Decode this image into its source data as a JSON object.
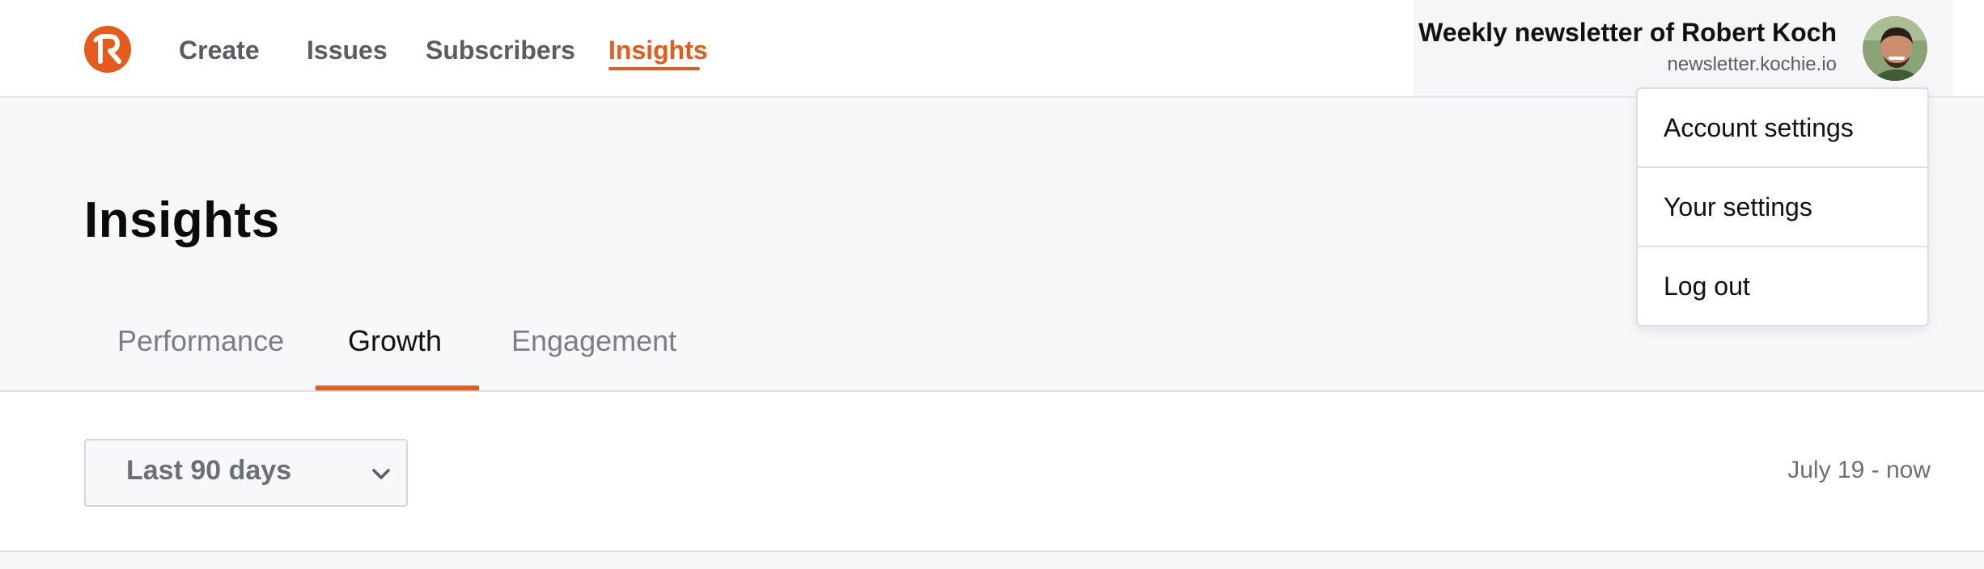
{
  "nav": {
    "logo_letter": "R",
    "links": [
      {
        "label": "Create",
        "active": false
      },
      {
        "label": "Issues",
        "active": false
      },
      {
        "label": "Subscribers",
        "active": false
      },
      {
        "label": "Insights",
        "active": true
      }
    ]
  },
  "account": {
    "title": "Weekly newsletter of Robert Koch",
    "domain": "newsletter.kochie.io",
    "avatar_icon": "user-avatar-photo"
  },
  "menu": {
    "items": [
      {
        "label": "Account settings"
      },
      {
        "label": "Your settings"
      },
      {
        "label": "Log out"
      }
    ]
  },
  "page": {
    "title": "Insights",
    "tabs": [
      {
        "label": "Performance",
        "active": false
      },
      {
        "label": "Growth",
        "active": true
      },
      {
        "label": "Engagement",
        "active": false
      }
    ]
  },
  "filter": {
    "period_selected": "Last 90 days",
    "date_range": "July 19 - now",
    "chevron_icon": "chevron-down-icon"
  },
  "colors": {
    "accent": "#e55b1c",
    "nav_text": "#585c63",
    "header_bg": "#f7f8fa"
  }
}
